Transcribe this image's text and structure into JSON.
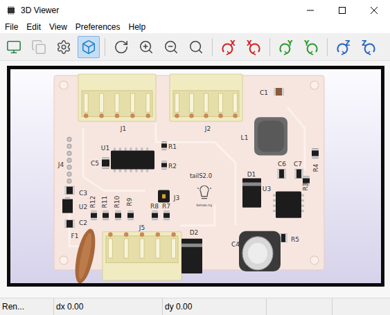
{
  "window": {
    "title": "3D Viewer"
  },
  "menu": [
    "File",
    "Edit",
    "View",
    "Preferences",
    "Help"
  ],
  "toolbar": [
    {
      "selected": false,
      "disabled": false
    },
    {
      "selected": false,
      "disabled": true
    },
    {
      "selected": false,
      "disabled": false
    },
    {
      "selected": true,
      "disabled": false
    },
    {
      "selected": false,
      "disabled": false
    },
    {
      "selected": false,
      "disabled": false
    },
    {
      "selected": false,
      "disabled": false
    },
    {
      "selected": false,
      "disabled": false
    },
    {
      "selected": false,
      "disabled": false,
      "axis": "X",
      "color": "#d42020"
    },
    {
      "selected": false,
      "disabled": false,
      "axis": "X",
      "color": "#d42020"
    },
    {
      "selected": false,
      "disabled": false,
      "axis": "Y",
      "color": "#2a9a2a"
    },
    {
      "selected": false,
      "disabled": false,
      "axis": "Y",
      "color": "#2a9a2a"
    },
    {
      "selected": false,
      "disabled": false,
      "axis": "Z",
      "color": "#2462c4"
    },
    {
      "selected": false,
      "disabled": false,
      "axis": "Z",
      "color": "#2462c4"
    }
  ],
  "board": {
    "labels": [
      "J1",
      "J2",
      "C1",
      "L1",
      "U1",
      "R1",
      "C5",
      "J4",
      "R2",
      "D1",
      "C6",
      "C7",
      "R4",
      "R3",
      "U3",
      "J3",
      "C3",
      "U2",
      "R12",
      "R11",
      "R10",
      "R9",
      "R8",
      "R7",
      "C2",
      "F1",
      "J5",
      "D2",
      "C4",
      "R5"
    ],
    "title": "tailS2.0",
    "subtitle": "benas.ny",
    "polarity": "+"
  },
  "status_bar": [
    "Ren...",
    "dx 0.00",
    "dy 0.00"
  ]
}
